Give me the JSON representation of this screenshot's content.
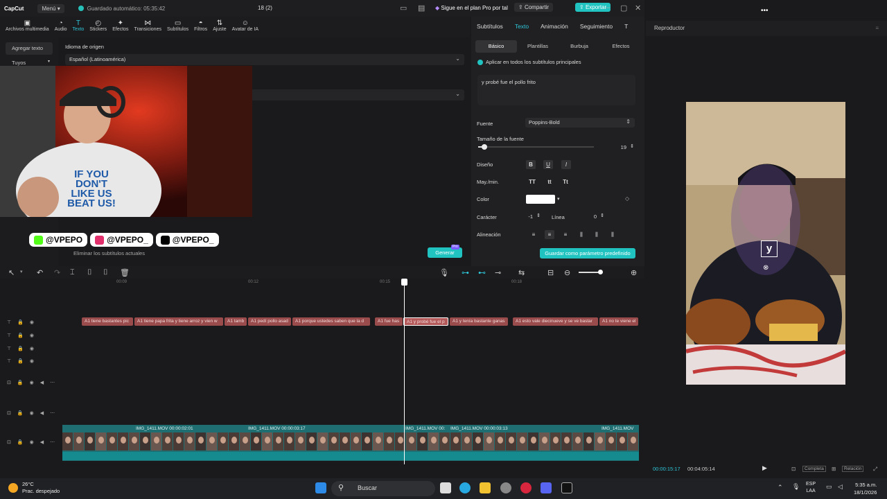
{
  "titlebar": {
    "app_name": "CapCut",
    "menu_label": "Menú",
    "autosave_text": "Guardado automático: 05:35:42",
    "project_name": "18 (2)",
    "plan_text": "Sigue en el plan Pro por tal",
    "share_label": "Compartir",
    "export_label": "Exportar"
  },
  "toolbar": {
    "items": [
      {
        "label": "Archivos multimedia",
        "icon": "media-icon"
      },
      {
        "label": "Audio",
        "icon": "audio-icon"
      },
      {
        "label": "Texto",
        "icon": "text-icon",
        "active": true
      },
      {
        "label": "Stickers",
        "icon": "sticker-icon"
      },
      {
        "label": "Efectos",
        "icon": "effects-icon"
      },
      {
        "label": "Transiciones",
        "icon": "transition-icon"
      },
      {
        "label": "Subtítulos",
        "icon": "subtitles-icon"
      },
      {
        "label": "Filtros",
        "icon": "filter-icon"
      },
      {
        "label": "Ajuste",
        "icon": "adjust-icon"
      },
      {
        "label": "Avatar de IA",
        "icon": "avatar-icon"
      }
    ]
  },
  "left_panel": {
    "add_text": "Agregar texto",
    "yours": "Tuyos"
  },
  "mid_panel": {
    "source_language_label": "Idioma de origen",
    "source_language_value": "Español (Latinoamérica)",
    "delete_current_subs": "Eliminar los subtítulos actuales",
    "generate_label": "Generar",
    "pro_badge": "Pro"
  },
  "socials": [
    {
      "handle": "@VPEPO",
      "icon": "kick-icon",
      "color": "#53fc18"
    },
    {
      "handle": "@VPEPO_",
      "icon": "instagram-icon",
      "color": "#e1306c"
    },
    {
      "handle": "@VPEPO_",
      "icon": "tiktok-icon",
      "color": "#000000"
    }
  ],
  "webcam": {
    "shirt_text": "IF YOU DON'T LIKE US BEAT US!"
  },
  "right_panel": {
    "tabs": [
      "Subtítulos",
      "Texto",
      "Animación",
      "Seguimiento",
      "T"
    ],
    "active_tab": "Texto",
    "subtabs": [
      "Básico",
      "Plantillas",
      "Burbuja",
      "Efectos"
    ],
    "apply_all_label": "Aplicar en todos los subtítulos principales",
    "text_value": "y probé fue el pollo frito",
    "font_label": "Fuente",
    "font_value": "Poppins-Bold",
    "font_size_label": "Tamaño de la fuente",
    "font_size_value": "19",
    "design_label": "Diseño",
    "design_buttons": [
      "B",
      "U",
      "I"
    ],
    "case_label": "May./min.",
    "case_buttons": [
      "TT",
      "tt",
      "Tt"
    ],
    "color_label": "Color",
    "color_value": "#ffffff",
    "character_label": "Carácter",
    "character_value": "-1",
    "line_label": "Línea",
    "line_value": "0",
    "align_label": "Alineación",
    "save_preset_label": "Guardar como parámetro predefinido"
  },
  "player": {
    "title": "Reproductor",
    "current_time": "00:00:15:17",
    "total_time": "00:04:05:14",
    "complete_label": "Completa",
    "ratio_label": "Relación",
    "caption_preview": "y"
  },
  "timeline": {
    "ruler_ticks": [
      "00:09",
      "00:12",
      "00:15",
      "00:18"
    ],
    "subtitle_clips": [
      {
        "text": "tiene bastantes pic"
      },
      {
        "text": "tiene papa frita y tiene arroz y vien w"
      },
      {
        "text": "tamb"
      },
      {
        "text": "pedí pollo asad"
      },
      {
        "text": "porque ustedes saben que la d"
      },
      {
        "text": "fue has"
      },
      {
        "text": "y probé fue el p",
        "selected": true
      },
      {
        "text": "y tenía bastante ganas"
      },
      {
        "text": "esto vale diecinueve y se ve bastar"
      },
      {
        "text": "no te viene el"
      }
    ],
    "video_labels": [
      "IMG_1411.MOV   00:00:02:01",
      "IMG_1411.MOV   00:00:03:17",
      "IMG_1411.MOV   00:",
      "IMG_1411.MOV   00:00:03:13",
      "IMG_1411.MOV"
    ]
  },
  "taskbar": {
    "temp": "26°C",
    "weather": "Prac. despejado",
    "search_placeholder": "Buscar",
    "lang": "ESP",
    "lang2": "LAA",
    "time": "5:35 a.m.",
    "date": "18/1/2026"
  }
}
